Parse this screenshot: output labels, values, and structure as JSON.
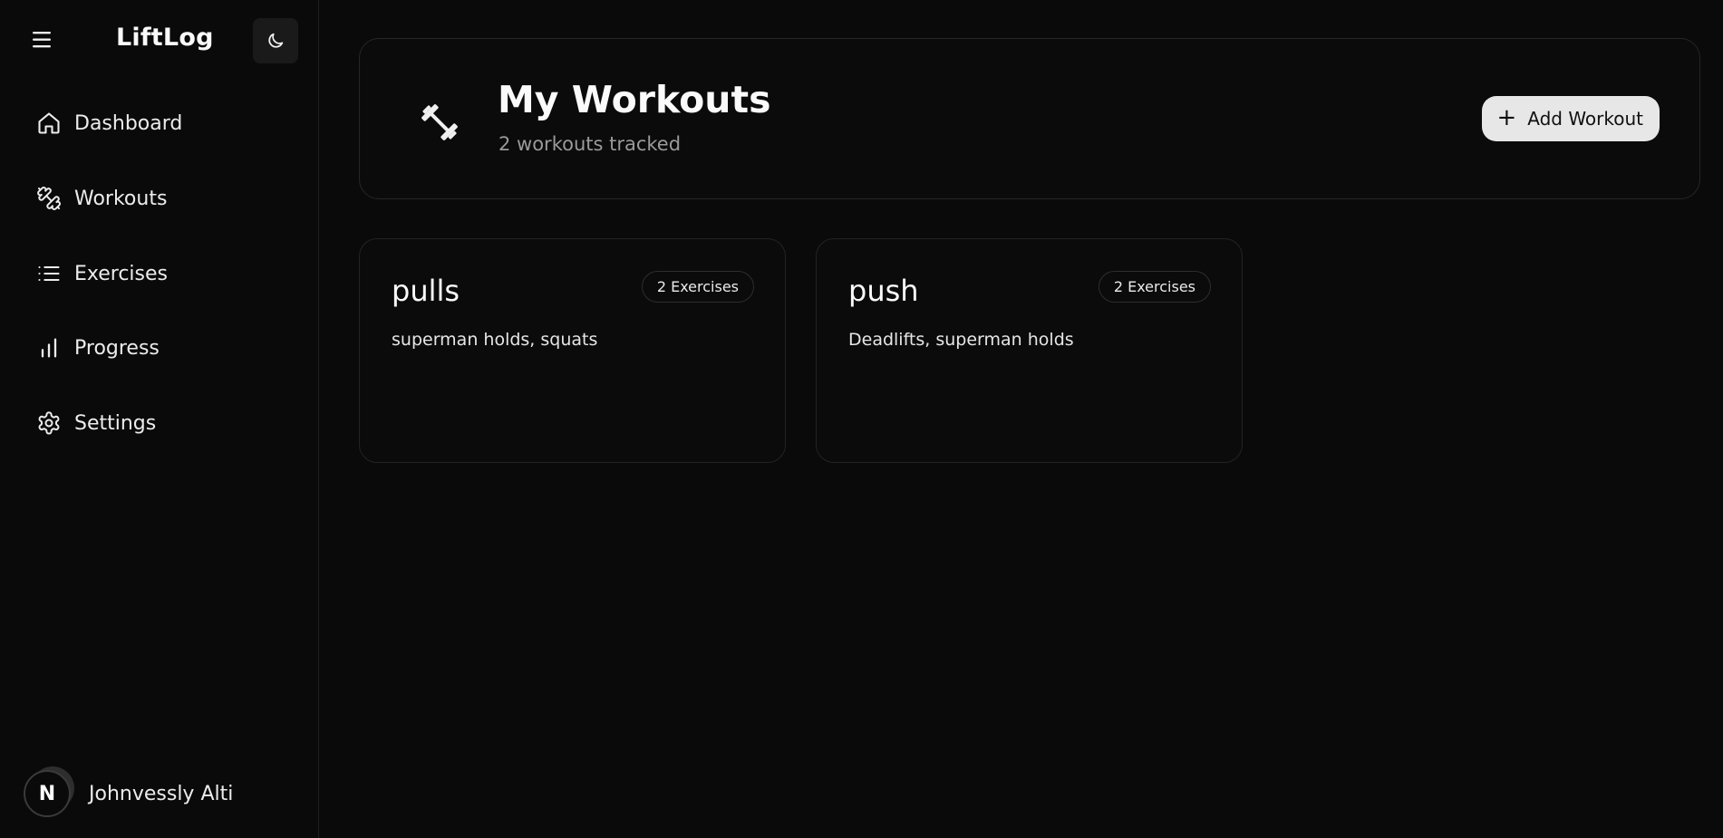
{
  "app": {
    "brand": "LiftLog"
  },
  "sidebar": {
    "items": [
      {
        "label": "Dashboard",
        "icon": "home-icon"
      },
      {
        "label": "Workouts",
        "icon": "dumbbell-icon"
      },
      {
        "label": "Exercises",
        "icon": "list-icon"
      },
      {
        "label": "Progress",
        "icon": "bar-chart-icon"
      },
      {
        "label": "Settings",
        "icon": "gear-icon"
      }
    ],
    "user": {
      "initial": "N",
      "name": "Johnvessly Alti"
    }
  },
  "header": {
    "title": "My Workouts",
    "subtitle": "2 workouts tracked",
    "add_label": "Add Workout",
    "add_icon": "plus-icon"
  },
  "workouts": [
    {
      "name": "pulls",
      "badge": "2 Exercises",
      "exercises": "superman holds, squats"
    },
    {
      "name": "push",
      "badge": "2 Exercises",
      "exercises": "Deadlifts, superman holds"
    }
  ],
  "colors": {
    "background": "#0a0a0a",
    "card_border": "#262626",
    "button_bg": "#e7e7e7",
    "muted_text": "#9a9a9a"
  }
}
